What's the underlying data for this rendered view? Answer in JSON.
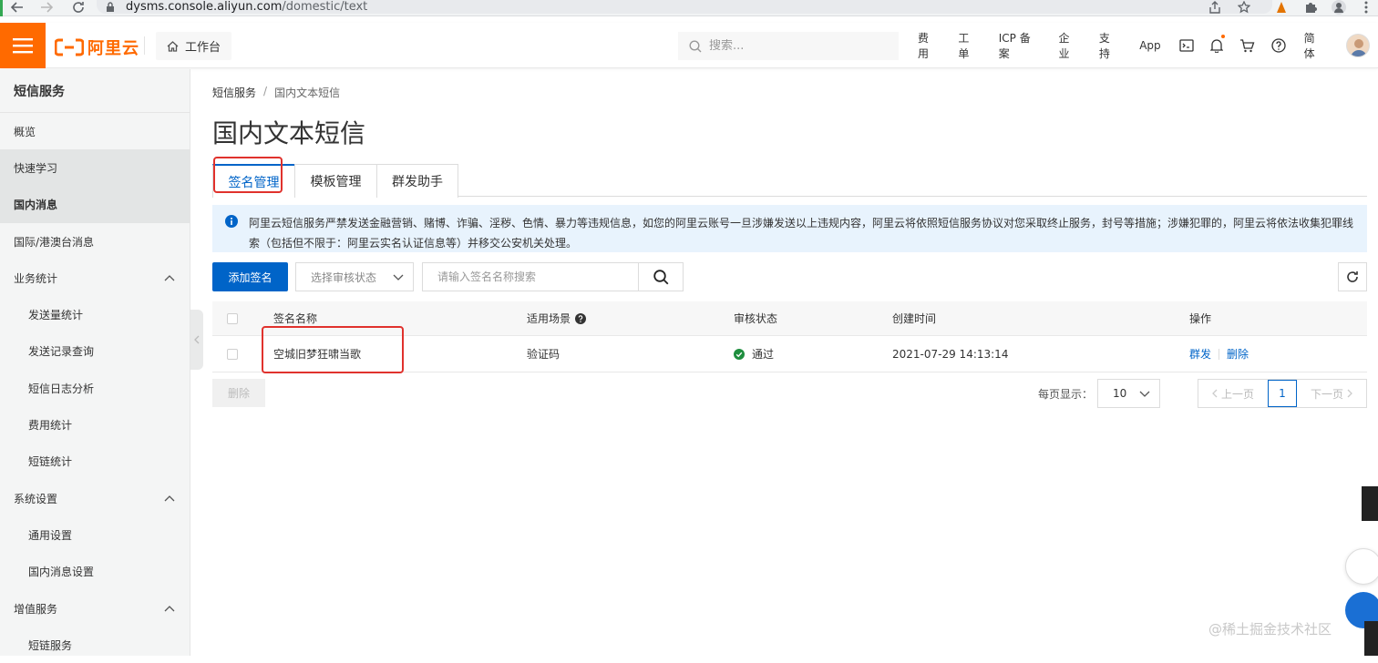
{
  "browser": {
    "url_host": "dysms.console.aliyun.com",
    "url_path": "/domestic/text"
  },
  "topbar": {
    "logo_text": "阿里云",
    "workbench": "工作台",
    "search_placeholder": "搜索...",
    "nav": [
      "费用",
      "工单",
      "ICP 备案",
      "企业",
      "支持",
      "App"
    ],
    "lang": "简体",
    "accent": "#ff6a00"
  },
  "sidebar": {
    "title": "短信服务",
    "items": [
      {
        "label": "概览"
      },
      {
        "label": "快速学习"
      },
      {
        "label": "国内消息"
      },
      {
        "label": "国际/港澳台消息"
      },
      {
        "label": "业务统计"
      },
      {
        "label": "发送量统计"
      },
      {
        "label": "发送记录查询"
      },
      {
        "label": "短信日志分析"
      },
      {
        "label": "费用统计"
      },
      {
        "label": "短链统计"
      },
      {
        "label": "系统设置"
      },
      {
        "label": "通用设置"
      },
      {
        "label": "国内消息设置"
      },
      {
        "label": "增值服务"
      },
      {
        "label": "短链服务"
      }
    ]
  },
  "breadcrumb": {
    "root": "短信服务",
    "sep": "/",
    "current": "国内文本短信"
  },
  "page_title": "国内文本短信",
  "tabs": [
    "签名管理",
    "模板管理",
    "群发助手"
  ],
  "notice": "阿里云短信服务严禁发送金融营销、赌博、诈骗、淫秽、色情、暴力等违规信息，如您的阿里云账号一旦涉嫌发送以上违规内容，阿里云将依照短信服务协议对您采取终止服务，封号等措施；涉嫌犯罪的，阿里云将依法收集犯罪线索（包括但不限于：阿里云实名认证信息等）并移交公安机关处理。",
  "toolbar": {
    "add_label": "添加签名",
    "status_placeholder": "选择审核状态",
    "search_placeholder": "请输入签名名称搜索"
  },
  "table": {
    "columns": [
      "签名名称",
      "适用场景",
      "审核状态",
      "创建时间",
      "操作"
    ],
    "rows": [
      {
        "name": "空城旧梦狂啸当歌",
        "scene": "验证码",
        "status": "通过",
        "created": "2021-07-29 14:13:14",
        "ops": [
          "群发",
          "删除"
        ]
      }
    ]
  },
  "footer": {
    "delete_label": "删除",
    "per_page_label": "每页显示：",
    "per_page_value": "10",
    "prev": "上一页",
    "page": "1",
    "next": "下一页"
  },
  "watermark": "@稀土掘金技术社区"
}
